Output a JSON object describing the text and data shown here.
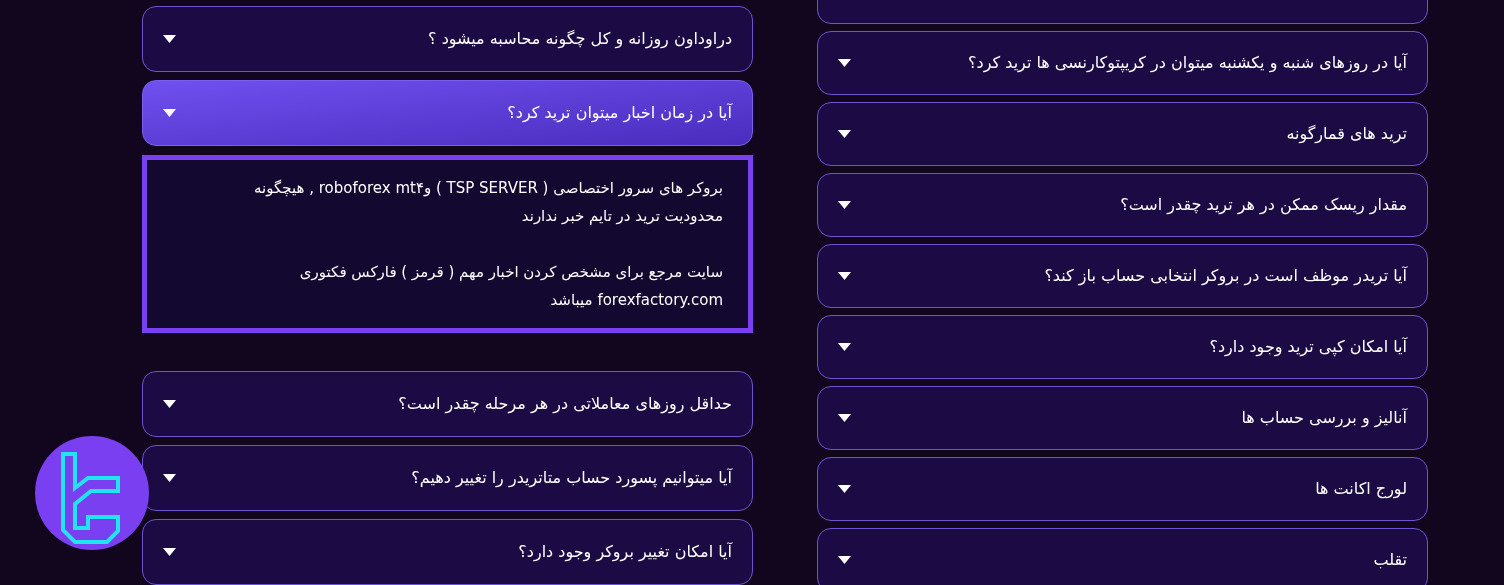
{
  "left_column": [
    {
      "question": "دراوداون روزانه و کل چگونه محاسبه میشود ؟",
      "expanded": false
    },
    {
      "question": "آیا در زمان اخبار میتوان ترید کرد؟",
      "expanded": true,
      "answer": [
        "بروکر های سرور اختصاصی ( TSP SERVER ) وroboforex mt۴ , هیچگونه محدودیت ترید در تایم خبر ندارند",
        "سایت مرجع برای مشخص کردن اخبار مهم ( قرمز ) فارکس فکتوری forexfactory.com میباشد"
      ]
    },
    {
      "question": "حداقل روزهای معاملاتی در هر مرحله چقدر است؟",
      "expanded": false
    },
    {
      "question": "آیا میتوانیم پسورد حساب متاتریدر را تغییر دهیم؟",
      "expanded": false
    },
    {
      "question": "آیا امکان تغییر بروکر وجود دارد؟",
      "expanded": false
    }
  ],
  "right_column": [
    {
      "expanded": false
    },
    {
      "question": "آیا در روزهای شنبه و یکشنبه میتوان در کریپتوکارنسی ها ترید کرد؟",
      "expanded": false
    },
    {
      "question": "ترید های قمارگونه",
      "expanded": false
    },
    {
      "question": "مقدار ریسک ممکن در هر ترید چقدر است؟",
      "expanded": false
    },
    {
      "question": "آیا تریدر موظف است در بروکر انتخابی حساب باز کند؟",
      "expanded": false
    },
    {
      "question": "آیا امکان کپی ترید وجود دارد؟",
      "expanded": false
    },
    {
      "question": "آنالیز و بررسی حساب ها",
      "expanded": false
    },
    {
      "question": "لورج اکانت ها",
      "expanded": false
    },
    {
      "question": "تقلب",
      "expanded": false
    }
  ]
}
